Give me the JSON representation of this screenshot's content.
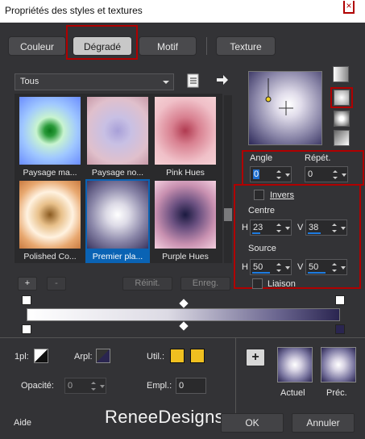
{
  "window": {
    "title": "Propriétés des styles et textures"
  },
  "tabs": [
    {
      "label": "Couleur",
      "active": false
    },
    {
      "label": "Dégradé",
      "active": true
    },
    {
      "label": "Motif",
      "active": false
    },
    {
      "label": "Texture",
      "active": false
    }
  ],
  "gallery": {
    "filter": "Tous",
    "items": [
      {
        "label": "Paysage ma...",
        "selected": false
      },
      {
        "label": "Paysage no...",
        "selected": false
      },
      {
        "label": "Pink Hues",
        "selected": false
      },
      {
        "label": "Polished Co...",
        "selected": false
      },
      {
        "label": "Premier pla...",
        "selected": true
      },
      {
        "label": "Purple Hues",
        "selected": false
      }
    ]
  },
  "gradient": {
    "angle_label": "Angle",
    "angle": "0",
    "repeat_label": "Répét.",
    "repeat": "0",
    "invert_label": "Invers",
    "invert": false,
    "centre_label": "Centre",
    "centre_h_label": "H",
    "centre_h": "23",
    "centre_v_label": "V",
    "centre_v": "38",
    "source_label": "Source",
    "source_h_label": "H",
    "source_h": "50",
    "source_v_label": "V",
    "source_v": "50",
    "link_label": "Liaison",
    "link": false
  },
  "editor": {
    "add_label": "+",
    "remove_label": "-",
    "reset_label": "Réinit.",
    "save_label": "Enreg."
  },
  "bottom": {
    "plan_label": "1pl:",
    "arpl_label": "Arpl:",
    "util_label": "Util.:",
    "opacity_label": "Opacité:",
    "opacity": "0",
    "empl_label": "Empl.:",
    "empl": "0",
    "current_label": "Actuel",
    "previous_label": "Préc.",
    "add_label": "+"
  },
  "footer": {
    "help_label": "Aide",
    "ok_label": "OK",
    "cancel_label": "Annuler",
    "watermark": "ReneeDesigns"
  },
  "colors": {
    "selection": "#0a63b4",
    "highlight_box": "#b00000",
    "accent_bar": "#1e7be0",
    "swatch_yellow": "#f0c020"
  }
}
